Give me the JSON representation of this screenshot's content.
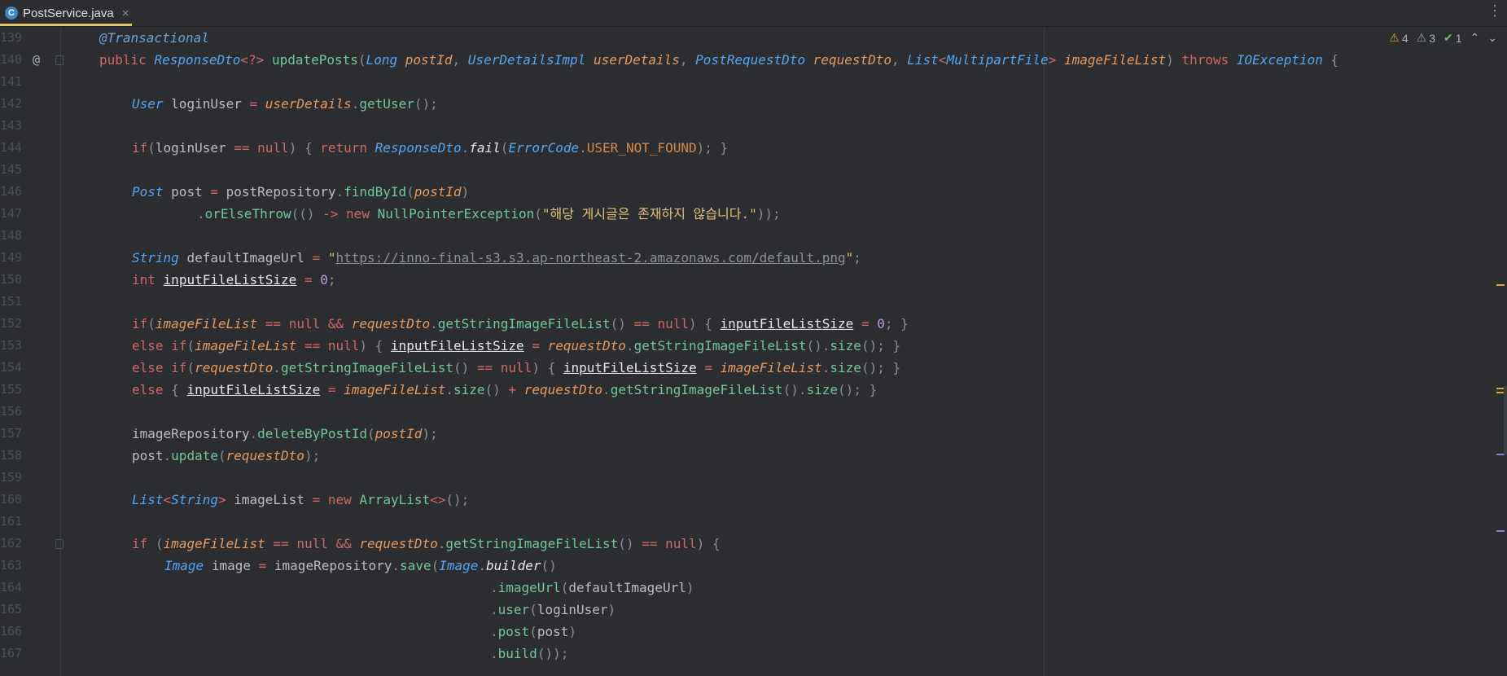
{
  "tab": {
    "icon": "C",
    "filename": "PostService.java",
    "close": "×",
    "menu": "⋮"
  },
  "inspection": {
    "warnings": "4",
    "weak_warnings": "3",
    "ok": "1",
    "up": "⌃",
    "down": "⌄"
  },
  "gutter": {
    "override_marker": "@"
  },
  "line_numbers": [
    "139",
    "140",
    "141",
    "142",
    "143",
    "144",
    "145",
    "146",
    "147",
    "148",
    "149",
    "150",
    "151",
    "152",
    "153",
    "154",
    "155",
    "156",
    "157",
    "158",
    "159",
    "160",
    "161",
    "162",
    "163",
    "164",
    "165",
    "166",
    "167"
  ],
  "code": {
    "l139": {
      "annotation": "@Transactional"
    },
    "l140": {
      "public": "public",
      "ret_type": "ResponseDto",
      "generic": "<?>",
      "method": "updatePosts",
      "t1": "Long",
      "p1": "postId",
      "t2": "UserDetailsImpl",
      "p2": "userDetails",
      "t3": "PostRequestDto",
      "p3": "requestDto",
      "t4": "List",
      "t4a": "MultipartFile",
      "p4": "imageFileList",
      "throws": "throws",
      "ex": "IOException"
    },
    "l142": {
      "type": "User",
      "var": "loginUser",
      "obj": "userDetails",
      "call": "getUser"
    },
    "l144": {
      "if": "if",
      "var": "loginUser",
      "null": "null",
      "return": "return",
      "cls": "ResponseDto",
      "fail": "fail",
      "enum": "ErrorCode",
      "const": "USER_NOT_FOUND"
    },
    "l146": {
      "type": "Post",
      "var": "post",
      "repo": "postRepository",
      "call": "findById",
      "arg": "postId"
    },
    "l147": {
      "call": "orElseThrow",
      "new": "new",
      "ex": "NullPointerException",
      "msg": "\"해당 게시글은 존재하지 않습니다.\""
    },
    "l149": {
      "type": "String",
      "var": "defaultImageUrl",
      "url": "https://inno-final-s3.s3.ap-northeast-2.amazonaws.com/default.png"
    },
    "l150": {
      "type": "int",
      "var": "inputFileListSize",
      "zero": "0"
    },
    "l152": {
      "if": "if",
      "v1": "imageFileList",
      "null": "null",
      "v2": "requestDto",
      "call": "getStringImageFileList",
      "var": "inputFileListSize",
      "zero": "0"
    },
    "l153": {
      "else": "else if",
      "v1": "imageFileList",
      "null": "null",
      "var": "inputFileListSize",
      "v2": "requestDto",
      "call": "getStringImageFileList",
      "size": "size"
    },
    "l154": {
      "else": "else if",
      "v2": "requestDto",
      "call": "getStringImageFileList",
      "null": "null",
      "var": "inputFileListSize",
      "v1": "imageFileList",
      "size": "size"
    },
    "l155": {
      "else": "else",
      "var": "inputFileListSize",
      "v1": "imageFileList",
      "size": "size",
      "v2": "requestDto",
      "call": "getStringImageFileList"
    },
    "l157": {
      "repo": "imageRepository",
      "call": "deleteByPostId",
      "arg": "postId"
    },
    "l158": {
      "obj": "post",
      "call": "update",
      "arg": "requestDto"
    },
    "l160": {
      "type": "List",
      "ta": "String",
      "var": "imageList",
      "new": "new",
      "cls": "ArrayList",
      "diamond": "<>"
    },
    "l162": {
      "if": "if",
      "v1": "imageFileList",
      "null": "null",
      "v2": "requestDto",
      "call": "getStringImageFileList"
    },
    "l163": {
      "type": "Image",
      "var": "image",
      "repo": "imageRepository",
      "call": "save",
      "cls": "Image",
      "builder": "builder"
    },
    "l164": {
      "call": "imageUrl",
      "arg": "defaultImageUrl"
    },
    "l165": {
      "call": "user",
      "arg": "loginUser"
    },
    "l166": {
      "call": "post",
      "arg": "post"
    },
    "l167": {
      "call": "build"
    }
  }
}
